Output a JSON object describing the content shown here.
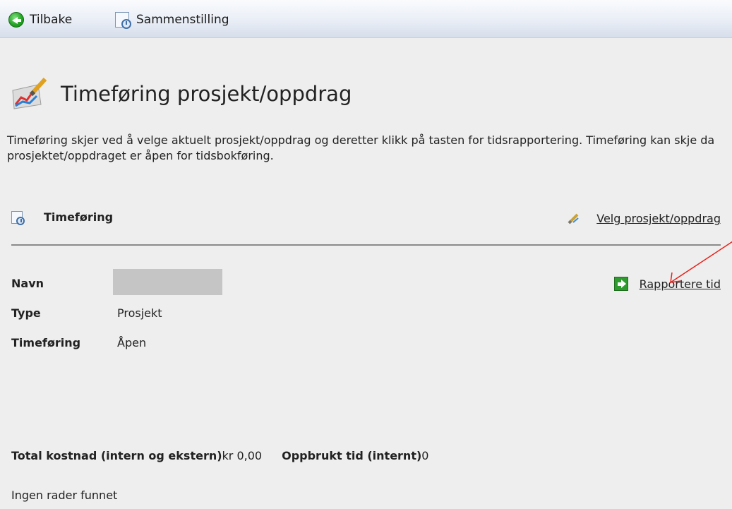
{
  "toolbar": {
    "back_label": "Tilbake",
    "summary_label": "Sammenstilling"
  },
  "page": {
    "title": "Timeføring prosjekt/oppdrag",
    "description": "Timeføring skjer ved å velge aktuelt prosjekt/oppdrag og deretter klikk på tasten for tidsrapportering. Timeføring kan skje da prosjektet/oppdraget er åpen for tidsbokføring."
  },
  "section": {
    "title": "Timeføring",
    "select_link": "Velg prosjekt/oppdrag"
  },
  "details": {
    "name_label": "Navn",
    "type_label": "Type",
    "type_value": "Prosjekt",
    "status_label": "Timeføring",
    "status_value": "Åpen",
    "report_link": "Rapportere tid"
  },
  "totals": {
    "cost_label": "Total kostnad (intern og ekstern)",
    "cost_value": "kr 0,00",
    "time_label": "Oppbrukt tid (internt)",
    "time_value": "0"
  },
  "table": {
    "empty_text": "Ingen rader funnet"
  },
  "colors": {
    "background": "#eeeeee",
    "annotation_arrow": "#e8201a",
    "accent_green": "#2e9b2e"
  }
}
